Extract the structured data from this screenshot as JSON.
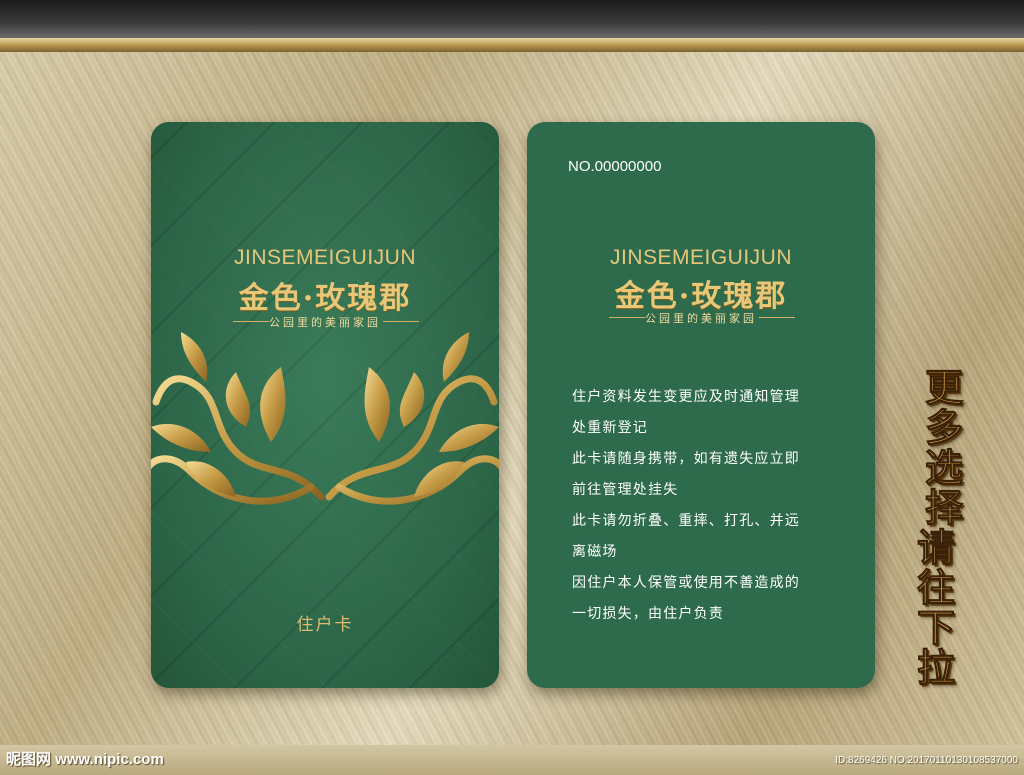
{
  "front": {
    "brand_en": "JINSEMEIGUIJUN",
    "brand_cn": "金色·玫瑰郡",
    "tagline": "公园里的美丽家园",
    "card_type": "住户卡"
  },
  "back": {
    "card_no": "NO.00000000",
    "brand_en": "JINSEMEIGUIJUN",
    "brand_cn": "金色·玫瑰郡",
    "tagline": "公园里的美丽家园",
    "rules": [
      "住户资料发生变更应及时通知管理",
      "处重新登记",
      "此卡请随身携带，如有遗失应立即",
      "前往管理处挂失",
      "此卡请勿折叠、重摔、打孔、并远",
      "离磁场",
      "因住户本人保管或使用不善造成的",
      "一切损失，由住户负责"
    ]
  },
  "side_text": {
    "line1": "更多选择",
    "line2": "请往下拉"
  },
  "watermark": {
    "left": "昵图网 www.nipic.com",
    "right": "ID:8269426 NO:20170110130108537000"
  },
  "colors": {
    "card_green": "#2f6a4c",
    "gold": "#e8c777"
  }
}
